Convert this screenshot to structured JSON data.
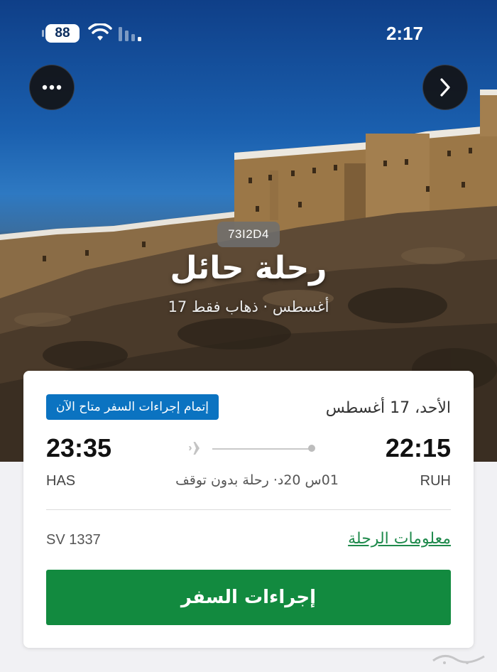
{
  "status_bar": {
    "battery": "88",
    "time": "2:17"
  },
  "booking": {
    "pnr": "73I2D4",
    "title": "رحلة حائل",
    "subtitle": "17 أغسطس · ذهاب فقط"
  },
  "flight": {
    "date": "الأحد، 17 أغسطس",
    "checkin_badge": "إتمام إجراءات السفر متاح الآن",
    "departure_time": "22:15",
    "departure_code": "RUH",
    "arrival_time": "23:35",
    "arrival_code": "HAS",
    "duration": "01س 20د· رحلة بدون توقف",
    "flight_number": "SV 1337",
    "info_link": "معلومات الرحلة",
    "checkin_button": "إجراءات السفر"
  },
  "icons": [
    "battery-icon",
    "wifi-icon",
    "signal-icon",
    "more-icon",
    "chevron-right-icon",
    "plane-icon"
  ],
  "colors": {
    "accent_green": "#128a3f",
    "link_green": "#1f8a4c",
    "badge_blue": "#0b73c1",
    "sky": "#1a5fae"
  }
}
